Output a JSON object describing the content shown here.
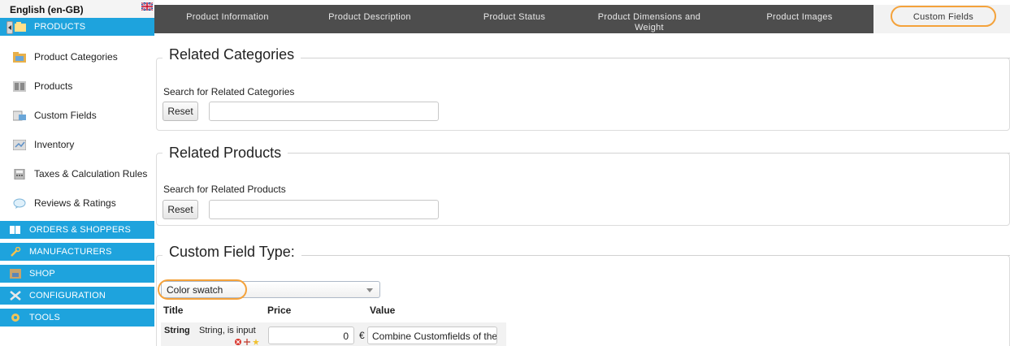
{
  "sidebar": {
    "language": "English (en-GB)",
    "products_header": "PRODUCTS",
    "product_items": [
      {
        "label": "Product Categories",
        "icon": "folder-icon"
      },
      {
        "label": "Products",
        "icon": "products-icon"
      },
      {
        "label": "Custom Fields",
        "icon": "custom-fields-icon"
      },
      {
        "label": "Inventory",
        "icon": "inventory-icon"
      },
      {
        "label": "Taxes & Calculation Rules",
        "icon": "calculator-icon"
      },
      {
        "label": "Reviews & Ratings",
        "icon": "speech-bubble-icon"
      }
    ],
    "sections": [
      {
        "label": "ORDERS & SHOPPERS",
        "icon": "orders-icon"
      },
      {
        "label": "MANUFACTURERS",
        "icon": "wrench-icon"
      },
      {
        "label": "SHOP",
        "icon": "shop-icon"
      },
      {
        "label": "CONFIGURATION",
        "icon": "configuration-icon"
      },
      {
        "label": "TOOLS",
        "icon": "tools-icon"
      }
    ]
  },
  "tabs": [
    {
      "label": "Product Information"
    },
    {
      "label": "Product Description"
    },
    {
      "label": "Product Status"
    },
    {
      "label": "Product Dimensions and Weight"
    },
    {
      "label": "Product Images"
    },
    {
      "label": "Custom Fields",
      "active": true
    }
  ],
  "related_categories": {
    "legend": "Related Categories",
    "search_label": "Search for Related Categories",
    "reset_label": "Reset",
    "search_value": ""
  },
  "related_products": {
    "legend": "Related Products",
    "search_label": "Search for Related Products",
    "reset_label": "Reset",
    "search_value": ""
  },
  "custom_field_type": {
    "legend": "Custom Field Type:",
    "selected": "Color swatch",
    "columns": [
      "Title",
      "Price",
      "Value"
    ],
    "rows": [
      {
        "title_bold": "String",
        "title_desc": "String, is input",
        "price": "0",
        "currency": "€",
        "value": "Combine Customfields of the"
      }
    ]
  },
  "colors": {
    "accent": "#1ea3dd",
    "tab_bar": "#4d4d4d",
    "highlight": "#f4a23b"
  }
}
